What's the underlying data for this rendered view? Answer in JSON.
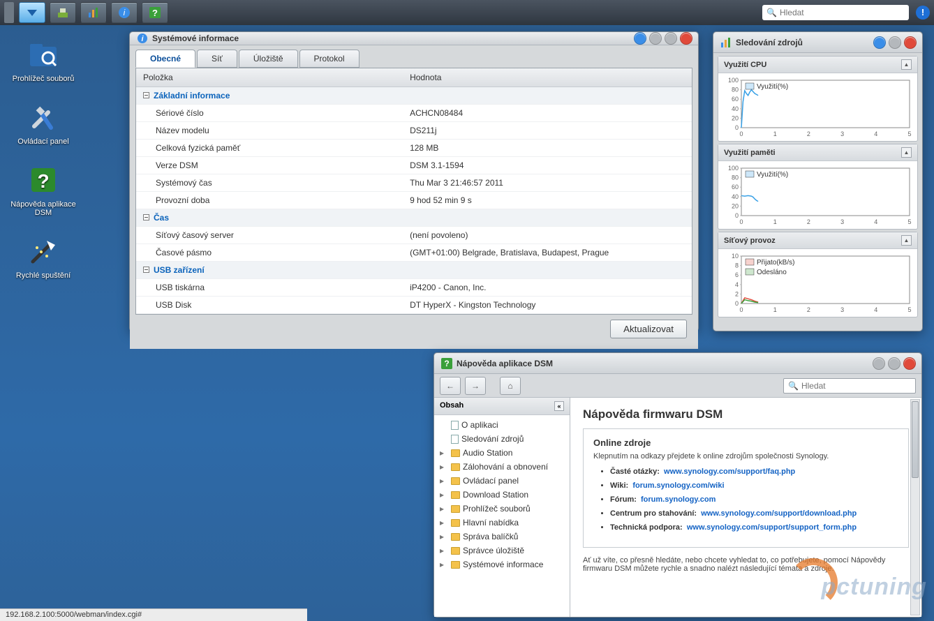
{
  "taskbar": {
    "search_placeholder": "Hledat"
  },
  "desktop_icons": [
    {
      "id": "file-browser",
      "label": "Prohlížeč souborů"
    },
    {
      "id": "control-panel",
      "label": "Ovládací panel"
    },
    {
      "id": "dsm-help",
      "label": "Nápověda aplikace DSM"
    },
    {
      "id": "quick-start",
      "label": "Rychlé spuštění"
    }
  ],
  "sysinfo": {
    "title": "Systémové informace",
    "tabs": [
      "Obecné",
      "Síť",
      "Úložiště",
      "Protokol"
    ],
    "col_item": "Položka",
    "col_val": "Hodnota",
    "groups": [
      {
        "name": "Základní informace",
        "rows": [
          [
            "Sériové číslo",
            "ACHCN08484"
          ],
          [
            "Název modelu",
            "DS211j"
          ],
          [
            "Celková fyzická paměť",
            "128 MB"
          ],
          [
            "Verze DSM",
            "DSM 3.1-1594"
          ],
          [
            "Systémový čas",
            "Thu Mar 3 21:46:57 2011"
          ],
          [
            "Provozní doba",
            "9 hod 52 min 9 s"
          ]
        ]
      },
      {
        "name": "Čas",
        "rows": [
          [
            "Síťový časový server",
            "(není povoleno)"
          ],
          [
            "Časové pásmo",
            "(GMT+01:00) Belgrade, Bratislava, Budapest, Prague"
          ]
        ]
      },
      {
        "name": "USB zařízení",
        "rows": [
          [
            "USB tiskárna",
            "iP4200 - Canon, Inc."
          ],
          [
            "USB Disk",
            "DT HyperX - Kingston Technology"
          ]
        ]
      }
    ],
    "refresh": "Aktualizovat"
  },
  "resmon": {
    "title": "Sledování zdrojů",
    "panels": {
      "cpu": "Využití CPU",
      "mem": "Využití paměti",
      "net": "Síťový provoz"
    },
    "legend_util": "Využití(%)",
    "legend_rx": "Přijato(kB/s)",
    "legend_tx": "Odesláno"
  },
  "help": {
    "title": "Nápověda aplikace DSM",
    "toc_title": "Obsah",
    "search_placeholder": "Hledat",
    "toc": [
      {
        "t": "doc",
        "l": "O aplikaci"
      },
      {
        "t": "doc",
        "l": "Sledování zdrojů"
      },
      {
        "t": "folder",
        "l": "Audio Station"
      },
      {
        "t": "folder",
        "l": "Zálohování a obnovení"
      },
      {
        "t": "folder",
        "l": "Ovládací panel"
      },
      {
        "t": "folder",
        "l": "Download Station"
      },
      {
        "t": "folder",
        "l": "Prohlížeč souborů"
      },
      {
        "t": "folder",
        "l": "Hlavní nabídka"
      },
      {
        "t": "folder",
        "l": "Správa balíčků"
      },
      {
        "t": "folder",
        "l": "Správce úložiště"
      },
      {
        "t": "folder",
        "l": "Systémové informace"
      }
    ],
    "page": {
      "h1": "Nápověda firmwaru DSM",
      "h3": "Online zdroje",
      "intro": "Klepnutím na odkazy přejdete k online zdrojům společnosti Synology.",
      "links": [
        {
          "k": "Časté otázky:",
          "u": "www.synology.com/support/faq.php"
        },
        {
          "k": "Wiki:",
          "u": "forum.synology.com/wiki"
        },
        {
          "k": "Fórum:",
          "u": "forum.synology.com"
        },
        {
          "k": "Centrum pro stahování:",
          "u": "www.synology.com/support/download.php"
        },
        {
          "k": "Technická podpora:",
          "u": "www.synology.com/support/support_form.php"
        }
      ],
      "outro": "Ať už víte, co přesně hledáte, nebo chcete vyhledat to, co potřebujete, pomocí Nápovědy firmwaru DSM můžete rychle a snadno nalézt následující témata a zdroje."
    }
  },
  "status_url": "192.168.2.100:5000/webman/index.cgi#",
  "watermark": "pctuning",
  "chart_data": [
    {
      "type": "line",
      "title": "Využití CPU",
      "ylabel": "%",
      "ylim": [
        0,
        100
      ],
      "xlim": [
        0,
        5
      ],
      "series": [
        {
          "name": "Využití(%)",
          "color": "#37a0e6",
          "x": [
            0,
            0.05,
            0.1,
            0.15,
            0.2,
            0.25,
            0.3,
            0.35,
            0.4,
            0.45,
            0.5
          ],
          "y": [
            0,
            55,
            78,
            72,
            68,
            75,
            80,
            76,
            72,
            70,
            68
          ]
        }
      ]
    },
    {
      "type": "line",
      "title": "Využití paměti",
      "ylabel": "%",
      "ylim": [
        0,
        100
      ],
      "xlim": [
        0,
        5
      ],
      "series": [
        {
          "name": "Využití(%)",
          "color": "#37a0e6",
          "x": [
            0,
            0.1,
            0.2,
            0.3,
            0.35,
            0.4,
            0.45,
            0.5
          ],
          "y": [
            42,
            41,
            42,
            41,
            39,
            35,
            32,
            30
          ]
        }
      ]
    },
    {
      "type": "line",
      "title": "Síťový provoz",
      "ylabel": "kB/s",
      "ylim": [
        0,
        10
      ],
      "xlim": [
        0,
        5
      ],
      "series": [
        {
          "name": "Přijato(kB/s)",
          "color": "#e04a3a",
          "x": [
            0,
            0.1,
            0.2,
            0.3,
            0.4,
            0.5
          ],
          "y": [
            0,
            1.2,
            1.0,
            0.8,
            0.5,
            0.3
          ]
        },
        {
          "name": "Odesláno",
          "color": "#3aa03a",
          "x": [
            0,
            0.1,
            0.2,
            0.3,
            0.4,
            0.5
          ],
          "y": [
            0,
            0.8,
            0.6,
            0.5,
            0.3,
            0.2
          ]
        }
      ]
    }
  ]
}
